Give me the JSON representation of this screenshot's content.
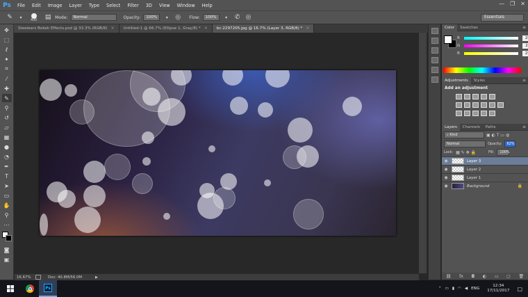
{
  "app": {
    "logo": "Ps"
  },
  "menu": [
    "File",
    "Edit",
    "Image",
    "Layer",
    "Type",
    "Select",
    "Filter",
    "3D",
    "View",
    "Window",
    "Help"
  ],
  "window_controls": [
    "—",
    "❐",
    "✕"
  ],
  "options": {
    "brush_size": "400",
    "mode_label": "Mode:",
    "mode_value": "Normal",
    "opacity_label": "Opacity:",
    "opacity_value": "100%",
    "flow_label": "Flow:",
    "flow_value": "100%",
    "workspace": "Essentials"
  },
  "tabs": [
    {
      "label": "Steeleers Bokeh Effects.psd @ 33.3% (RGB/8)"
    },
    {
      "label": "Untitled-1 @ 66.7% (Ellipse 1, Gray/8) *"
    },
    {
      "label": "bc-2297205.jpg @ 16.7% (Layer 3, RGB/8) *"
    }
  ],
  "tab_close": "×",
  "status": {
    "zoom": "16.67%",
    "doc": "Doc: 40.8M/56.0M"
  },
  "color_panel": {
    "tabs": [
      "Color",
      "Swatches"
    ],
    "rows": [
      {
        "label": "R",
        "value": "255",
        "color": "#ff0000"
      },
      {
        "label": "G",
        "value": "255",
        "color": "#00ff00"
      },
      {
        "label": "B",
        "value": "255",
        "color": "#0000ff"
      }
    ]
  },
  "adjust_panel": {
    "tabs": [
      "Adjustments",
      "Styles"
    ],
    "title": "Add an adjustment"
  },
  "layers_panel": {
    "tabs": [
      "Layers",
      "Channels",
      "Paths"
    ],
    "kind": "Kind",
    "blend": "Normal",
    "opacity_label": "Opacity:",
    "opacity_value": "62%",
    "lock_label": "Lock:",
    "fill_label": "Fill:",
    "fill_value": "100%",
    "layers": [
      {
        "name": "Layer 3",
        "selected": true
      },
      {
        "name": "Layer 2",
        "selected": false
      },
      {
        "name": "Layer 1",
        "selected": false
      },
      {
        "name": "Background",
        "selected": false
      }
    ]
  },
  "taskbar": {
    "lang": "ENG",
    "time": "12:34",
    "date": "17/11/2017"
  },
  "colors": {
    "accent": "#4fa8ff",
    "selected_layer": "#6b7d98"
  }
}
